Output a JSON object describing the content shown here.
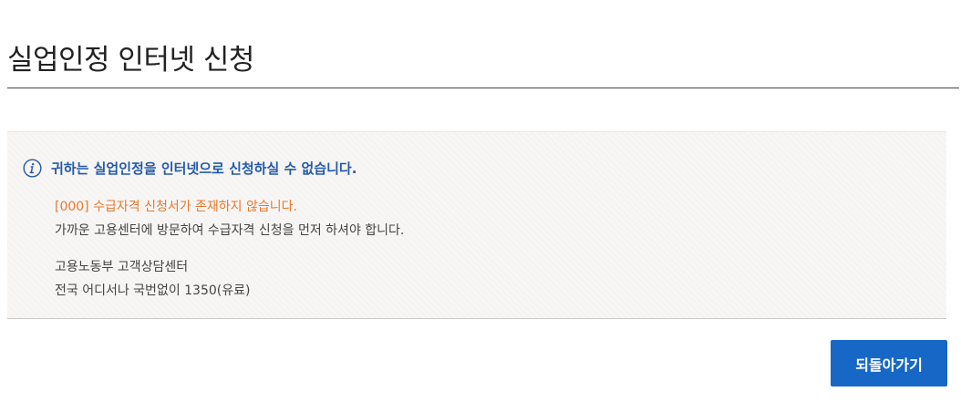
{
  "page": {
    "title": "실업인정 인터넷 신청"
  },
  "notice": {
    "icon": "info-icon",
    "heading": "귀하는 실업인정을 인터넷으로 신청하실 수 없습니다.",
    "error_message": "[000] 수급자격 신청서가 존재하지 않습니다.",
    "guide_message": "가까운 고용센터에 방문하여 수급자격 신청을 먼저 하셔야 합니다.",
    "contact_center": "고용노동부 고객상담센터",
    "contact_phone": "전국 어디서나 국번없이 1350(유료)"
  },
  "actions": {
    "back_label": "되돌아가기"
  },
  "colors": {
    "accent": "#1767c7",
    "heading_blue": "#245aa8",
    "error_orange": "#e8792e"
  }
}
